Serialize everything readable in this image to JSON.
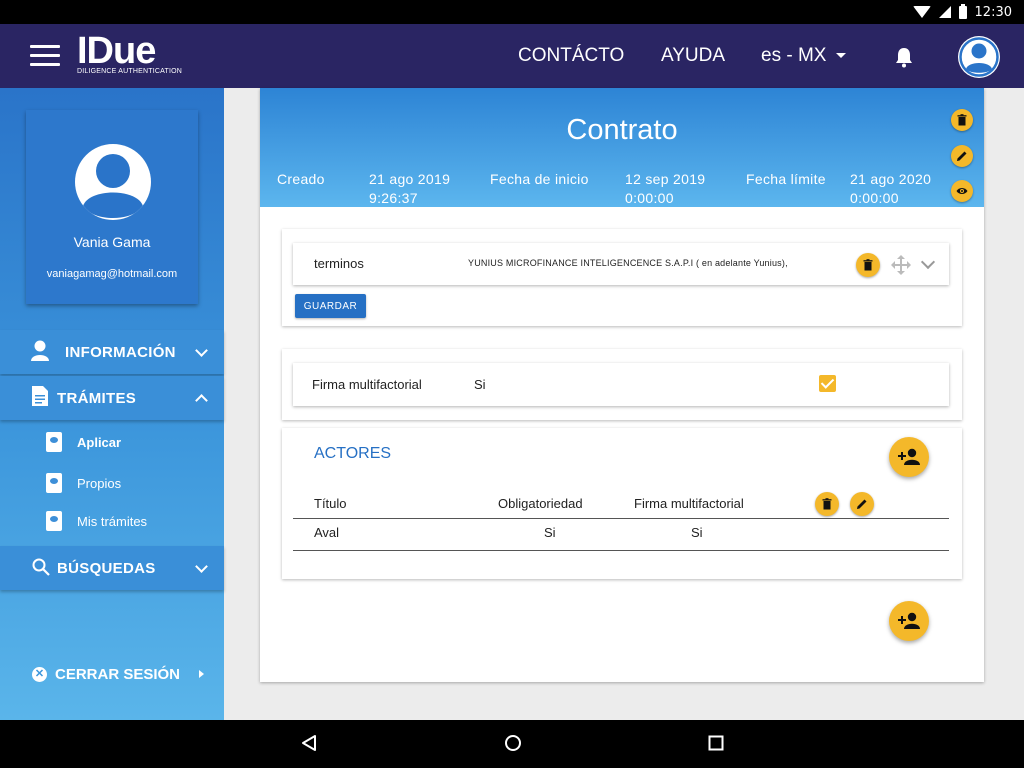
{
  "status_bar": {
    "time": "12:30"
  },
  "header": {
    "logo_text": "IDue",
    "logo_subtitle": "DILIGENCE AUTHENTICATION",
    "nav": {
      "contact": "CONTÁCTO",
      "help": "AYUDA",
      "language": "es - MX"
    }
  },
  "sidebar": {
    "profile": {
      "name": "Vania Gama",
      "email": "vaniagamag@hotmail.com"
    },
    "sections": {
      "info": "INFORMACIÓN",
      "procedures": "TRÁMITES",
      "searches": "BÚSQUEDAS"
    },
    "procedure_items": [
      "Aplicar",
      "Propios",
      "Mis trámites"
    ],
    "logout": "CERRAR SESIÓN"
  },
  "contract": {
    "title": "Contrato",
    "created_label": "Creado",
    "created_date": "21 ago 2019",
    "created_time": "9:26:37",
    "start_label": "Fecha de inicio",
    "start_date": "12 sep 2019",
    "start_time": "0:00:00",
    "limit_label": "Fecha límite",
    "limit_date": "21 ago 2020",
    "limit_time": "0:00:00"
  },
  "terms": {
    "label": "terminos",
    "text": "YUNIUS MICROFINANCE INTELIGENCENCE S.A.P.I ( en adelante Yunius),",
    "save_button": "GUARDAR"
  },
  "multifactor": {
    "label": "Firma multifactorial",
    "value": "Si",
    "checked": true
  },
  "actors": {
    "title": "ACTORES",
    "columns": [
      "Título",
      "Obligatoriedad",
      "Firma multifactorial"
    ],
    "rows": [
      {
        "title": "Aval",
        "mandatory": "Si",
        "multifactor": "Si"
      }
    ]
  },
  "colors": {
    "header": "#2a2563",
    "accent": "#f4b82a",
    "primary": "#2670c4"
  }
}
